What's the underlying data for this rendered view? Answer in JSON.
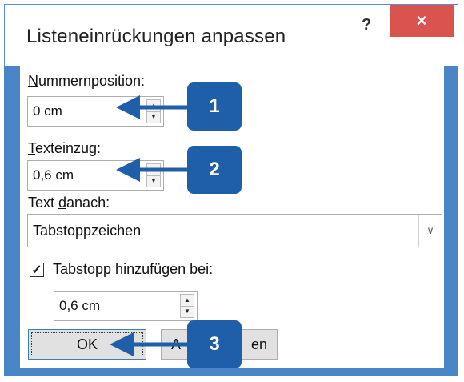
{
  "dialog": {
    "title": "Listeneinrückungen anpassen",
    "help_label": "?",
    "close_label": "×"
  },
  "number_position": {
    "label_underlined": "N",
    "label_rest": "ummernposition:",
    "value": "0 cm"
  },
  "text_indent": {
    "label_underlined": "T",
    "label_rest": "exteinzug:",
    "value": "0,6 cm"
  },
  "text_after": {
    "label_prefix": "Text ",
    "label_underlined": "d",
    "label_rest": "anach:",
    "selected": "Tabstoppzeichen",
    "dropdown_icon": "chevron-down"
  },
  "tab_stop": {
    "checked": true,
    "check_mark": "✓",
    "label_underlined": "T",
    "label_rest": "abstopp hinzufügen bei:",
    "value": "0,6 cm"
  },
  "buttons": {
    "ok_label": "OK",
    "cancel_label_visible_left": "A",
    "cancel_label_visible_right": "en"
  },
  "callouts": [
    "1",
    "2",
    "3"
  ],
  "colors": {
    "frame": "#4a85c8",
    "close_button": "#d9534f",
    "callout": "#1f5ea8"
  }
}
